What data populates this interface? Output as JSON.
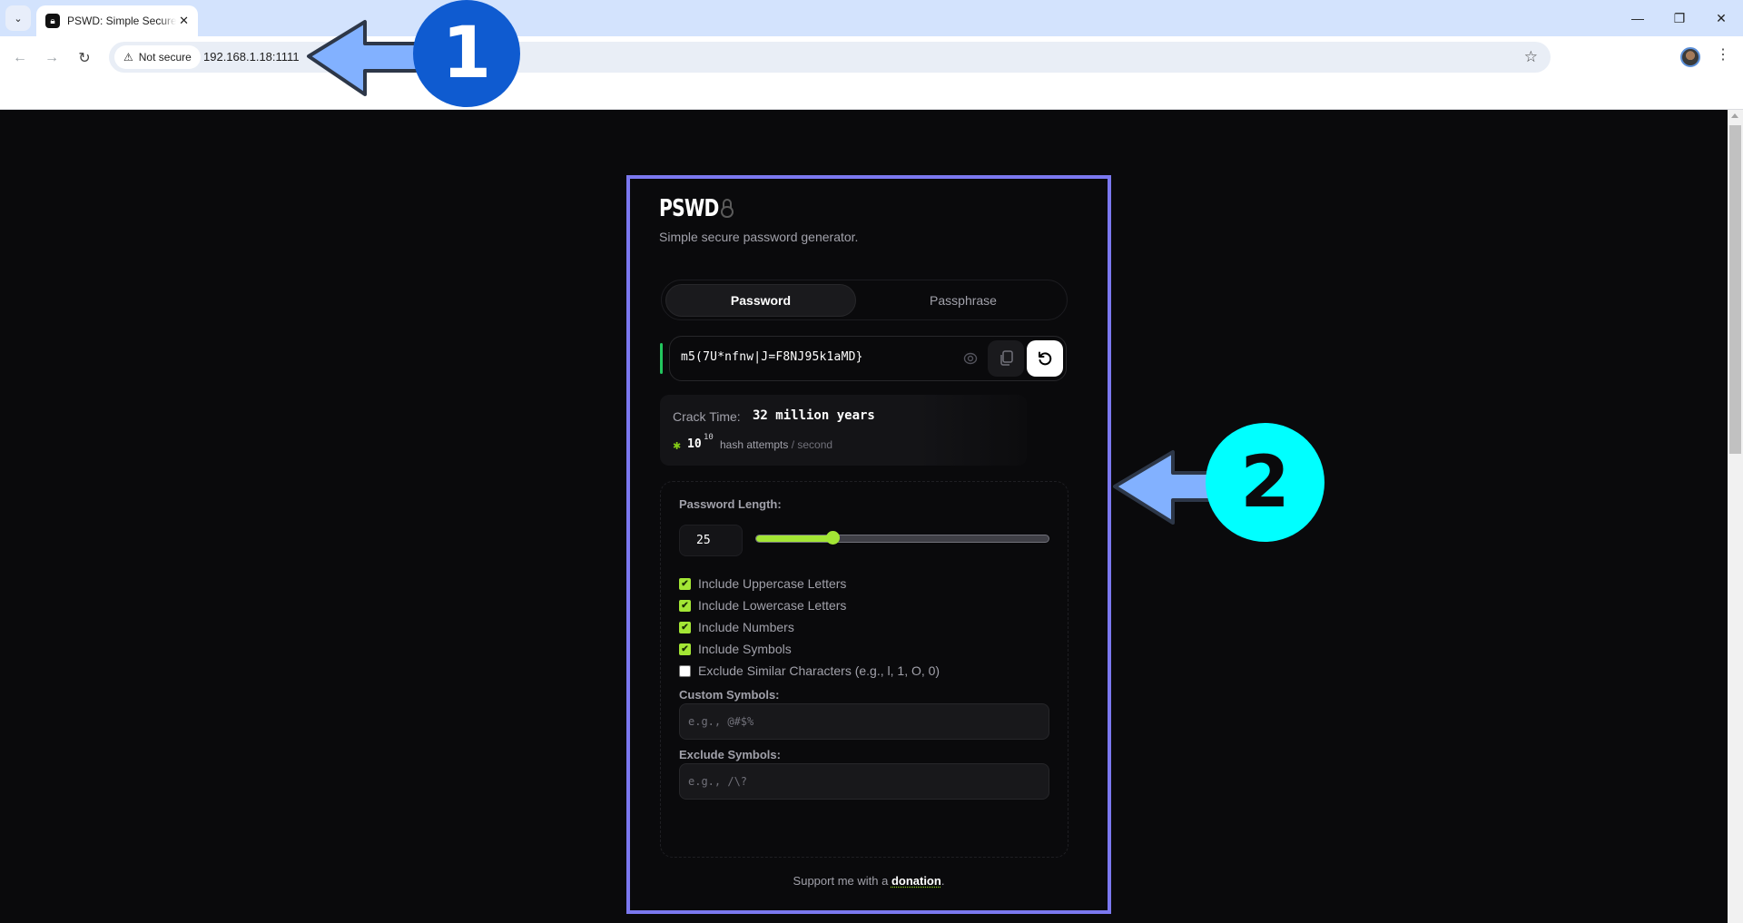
{
  "browser": {
    "tab_title": "PSWD: Simple Secure",
    "security_label": "Not secure",
    "url": "192.168.1.18:1111"
  },
  "app": {
    "title": "PSWD",
    "subtitle": "Simple secure password generator.",
    "mode_tabs": [
      {
        "label": "Password",
        "active": true
      },
      {
        "label": "Passphrase",
        "active": false
      }
    ],
    "password": {
      "value": "m5(7U*nfnw|J=F8NJ95k1aMD}",
      "strength_color": "#22c55e"
    },
    "crack": {
      "label": "Crack Time:",
      "value": "32 million years",
      "hash_base": "10",
      "hash_exponent": "10",
      "hash_text": "hash attempts",
      "hash_unit": "/ second"
    },
    "options": {
      "length_label": "Password Length:",
      "length_value": "25",
      "length_slider_fraction": 0.26,
      "checkboxes": [
        {
          "label": "Include Uppercase Letters",
          "checked": true
        },
        {
          "label": "Include Lowercase Letters",
          "checked": true
        },
        {
          "label": "Include Numbers",
          "checked": true
        },
        {
          "label": "Include Symbols",
          "checked": true
        },
        {
          "label": "Exclude Similar Characters (e.g., l, 1, O, 0)",
          "checked": false
        }
      ],
      "custom_symbols_label": "Custom Symbols:",
      "custom_symbols_placeholder": "e.g., @#$%",
      "exclude_symbols_label": "Exclude Symbols:",
      "exclude_symbols_placeholder": "e.g., /\\?"
    },
    "footer": {
      "text": "Support me with a ",
      "link": "donation",
      "suffix": "."
    },
    "accent_color": "#a3e635"
  },
  "annotations": [
    {
      "label": "1",
      "color": "#0f5bd0"
    },
    {
      "label": "2",
      "color": "#00ffff"
    }
  ],
  "annotation_highlight_color": "#7b78f0"
}
